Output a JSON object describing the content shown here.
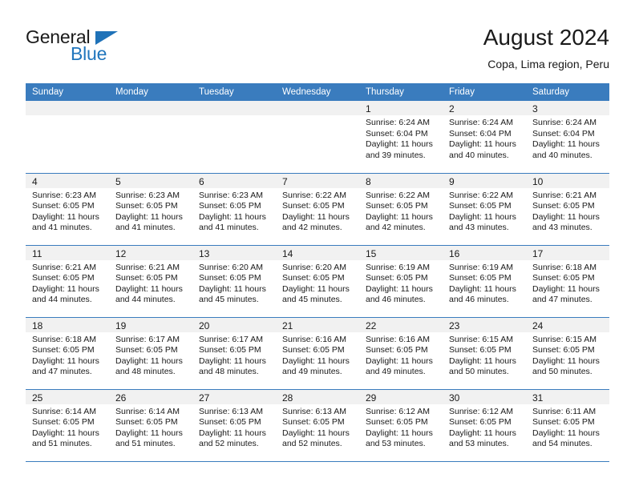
{
  "brand": {
    "name_top": "General",
    "name_bottom": "Blue",
    "accent_color": "#2176bd"
  },
  "header": {
    "title": "August 2024",
    "subtitle": "Copa, Lima region, Peru"
  },
  "theme": {
    "header_row_bg": "#3a7cbe",
    "header_row_text": "#ffffff",
    "daynum_band_bg": "#f1f1f1",
    "cell_bg": "#ffffff",
    "row_divider": "#3a7cbe",
    "text": "#1a1a1a"
  },
  "weekday_headers": [
    "Sunday",
    "Monday",
    "Tuesday",
    "Wednesday",
    "Thursday",
    "Friday",
    "Saturday"
  ],
  "weeks": [
    [
      {
        "empty": true,
        "day": "",
        "lines": []
      },
      {
        "empty": true,
        "day": "",
        "lines": []
      },
      {
        "empty": true,
        "day": "",
        "lines": []
      },
      {
        "empty": true,
        "day": "",
        "lines": []
      },
      {
        "empty": false,
        "day": "1",
        "lines": [
          "Sunrise: 6:24 AM",
          "Sunset: 6:04 PM",
          "Daylight: 11 hours",
          "and 39 minutes."
        ]
      },
      {
        "empty": false,
        "day": "2",
        "lines": [
          "Sunrise: 6:24 AM",
          "Sunset: 6:04 PM",
          "Daylight: 11 hours",
          "and 40 minutes."
        ]
      },
      {
        "empty": false,
        "day": "3",
        "lines": [
          "Sunrise: 6:24 AM",
          "Sunset: 6:04 PM",
          "Daylight: 11 hours",
          "and 40 minutes."
        ]
      }
    ],
    [
      {
        "empty": false,
        "day": "4",
        "lines": [
          "Sunrise: 6:23 AM",
          "Sunset: 6:05 PM",
          "Daylight: 11 hours",
          "and 41 minutes."
        ]
      },
      {
        "empty": false,
        "day": "5",
        "lines": [
          "Sunrise: 6:23 AM",
          "Sunset: 6:05 PM",
          "Daylight: 11 hours",
          "and 41 minutes."
        ]
      },
      {
        "empty": false,
        "day": "6",
        "lines": [
          "Sunrise: 6:23 AM",
          "Sunset: 6:05 PM",
          "Daylight: 11 hours",
          "and 41 minutes."
        ]
      },
      {
        "empty": false,
        "day": "7",
        "lines": [
          "Sunrise: 6:22 AM",
          "Sunset: 6:05 PM",
          "Daylight: 11 hours",
          "and 42 minutes."
        ]
      },
      {
        "empty": false,
        "day": "8",
        "lines": [
          "Sunrise: 6:22 AM",
          "Sunset: 6:05 PM",
          "Daylight: 11 hours",
          "and 42 minutes."
        ]
      },
      {
        "empty": false,
        "day": "9",
        "lines": [
          "Sunrise: 6:22 AM",
          "Sunset: 6:05 PM",
          "Daylight: 11 hours",
          "and 43 minutes."
        ]
      },
      {
        "empty": false,
        "day": "10",
        "lines": [
          "Sunrise: 6:21 AM",
          "Sunset: 6:05 PM",
          "Daylight: 11 hours",
          "and 43 minutes."
        ]
      }
    ],
    [
      {
        "empty": false,
        "day": "11",
        "lines": [
          "Sunrise: 6:21 AM",
          "Sunset: 6:05 PM",
          "Daylight: 11 hours",
          "and 44 minutes."
        ]
      },
      {
        "empty": false,
        "day": "12",
        "lines": [
          "Sunrise: 6:21 AM",
          "Sunset: 6:05 PM",
          "Daylight: 11 hours",
          "and 44 minutes."
        ]
      },
      {
        "empty": false,
        "day": "13",
        "lines": [
          "Sunrise: 6:20 AM",
          "Sunset: 6:05 PM",
          "Daylight: 11 hours",
          "and 45 minutes."
        ]
      },
      {
        "empty": false,
        "day": "14",
        "lines": [
          "Sunrise: 6:20 AM",
          "Sunset: 6:05 PM",
          "Daylight: 11 hours",
          "and 45 minutes."
        ]
      },
      {
        "empty": false,
        "day": "15",
        "lines": [
          "Sunrise: 6:19 AM",
          "Sunset: 6:05 PM",
          "Daylight: 11 hours",
          "and 46 minutes."
        ]
      },
      {
        "empty": false,
        "day": "16",
        "lines": [
          "Sunrise: 6:19 AM",
          "Sunset: 6:05 PM",
          "Daylight: 11 hours",
          "and 46 minutes."
        ]
      },
      {
        "empty": false,
        "day": "17",
        "lines": [
          "Sunrise: 6:18 AM",
          "Sunset: 6:05 PM",
          "Daylight: 11 hours",
          "and 47 minutes."
        ]
      }
    ],
    [
      {
        "empty": false,
        "day": "18",
        "lines": [
          "Sunrise: 6:18 AM",
          "Sunset: 6:05 PM",
          "Daylight: 11 hours",
          "and 47 minutes."
        ]
      },
      {
        "empty": false,
        "day": "19",
        "lines": [
          "Sunrise: 6:17 AM",
          "Sunset: 6:05 PM",
          "Daylight: 11 hours",
          "and 48 minutes."
        ]
      },
      {
        "empty": false,
        "day": "20",
        "lines": [
          "Sunrise: 6:17 AM",
          "Sunset: 6:05 PM",
          "Daylight: 11 hours",
          "and 48 minutes."
        ]
      },
      {
        "empty": false,
        "day": "21",
        "lines": [
          "Sunrise: 6:16 AM",
          "Sunset: 6:05 PM",
          "Daylight: 11 hours",
          "and 49 minutes."
        ]
      },
      {
        "empty": false,
        "day": "22",
        "lines": [
          "Sunrise: 6:16 AM",
          "Sunset: 6:05 PM",
          "Daylight: 11 hours",
          "and 49 minutes."
        ]
      },
      {
        "empty": false,
        "day": "23",
        "lines": [
          "Sunrise: 6:15 AM",
          "Sunset: 6:05 PM",
          "Daylight: 11 hours",
          "and 50 minutes."
        ]
      },
      {
        "empty": false,
        "day": "24",
        "lines": [
          "Sunrise: 6:15 AM",
          "Sunset: 6:05 PM",
          "Daylight: 11 hours",
          "and 50 minutes."
        ]
      }
    ],
    [
      {
        "empty": false,
        "day": "25",
        "lines": [
          "Sunrise: 6:14 AM",
          "Sunset: 6:05 PM",
          "Daylight: 11 hours",
          "and 51 minutes."
        ]
      },
      {
        "empty": false,
        "day": "26",
        "lines": [
          "Sunrise: 6:14 AM",
          "Sunset: 6:05 PM",
          "Daylight: 11 hours",
          "and 51 minutes."
        ]
      },
      {
        "empty": false,
        "day": "27",
        "lines": [
          "Sunrise: 6:13 AM",
          "Sunset: 6:05 PM",
          "Daylight: 11 hours",
          "and 52 minutes."
        ]
      },
      {
        "empty": false,
        "day": "28",
        "lines": [
          "Sunrise: 6:13 AM",
          "Sunset: 6:05 PM",
          "Daylight: 11 hours",
          "and 52 minutes."
        ]
      },
      {
        "empty": false,
        "day": "29",
        "lines": [
          "Sunrise: 6:12 AM",
          "Sunset: 6:05 PM",
          "Daylight: 11 hours",
          "and 53 minutes."
        ]
      },
      {
        "empty": false,
        "day": "30",
        "lines": [
          "Sunrise: 6:12 AM",
          "Sunset: 6:05 PM",
          "Daylight: 11 hours",
          "and 53 minutes."
        ]
      },
      {
        "empty": false,
        "day": "31",
        "lines": [
          "Sunrise: 6:11 AM",
          "Sunset: 6:05 PM",
          "Daylight: 11 hours",
          "and 54 minutes."
        ]
      }
    ]
  ]
}
